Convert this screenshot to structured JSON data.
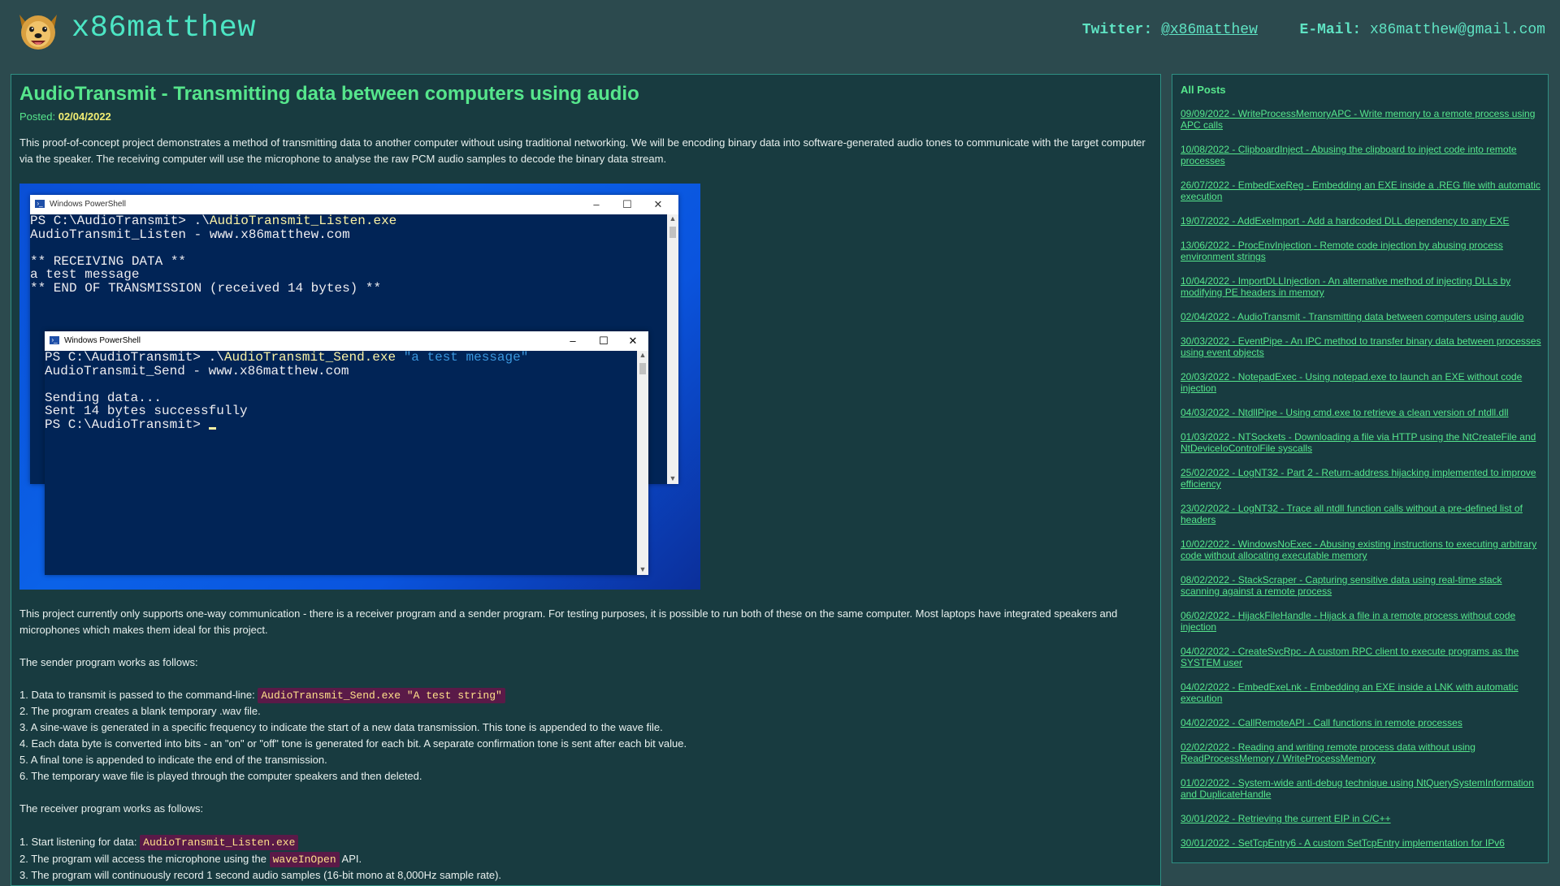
{
  "header": {
    "site_title": "x86matthew",
    "logo_icon": "dog-face-logo-icon",
    "twitter_label": "Twitter:",
    "twitter_handle": "@x86matthew",
    "email_label": "E-Mail:",
    "email_address": "x86matthew@gmail.com"
  },
  "article": {
    "title": "AudioTransmit - Transmitting data between computers using audio",
    "posted_label": "Posted:",
    "posted_date": "02/04/2022",
    "intro": "This proof-of-concept project demonstrates a method of transmitting data to another computer without using traditional networking. We will be encoding binary data into software-generated audio tones to communicate with the target computer via the speaker. The receiving computer will use the microphone to analyse the raw PCM audio samples to decode the binary data stream.",
    "screenshot": {
      "back_window": {
        "title": "Windows PowerShell",
        "prompt": "PS C:\\AudioTransmit> .\\",
        "exe": "AudioTransmit_Listen.exe",
        "lines": [
          "AudioTransmit_Listen - www.x86matthew.com",
          "",
          "** RECEIVING DATA **",
          "a test message",
          "** END OF TRANSMISSION (received 14 bytes) **"
        ]
      },
      "front_window": {
        "title": "Windows PowerShell",
        "prompt": "PS C:\\AudioTransmit> .\\",
        "exe": "AudioTransmit_Send.exe",
        "arg": "\"a test message\"",
        "lines": [
          "AudioTransmit_Send - www.x86matthew.com",
          "",
          "Sending data...",
          "Sent 14 bytes successfully"
        ],
        "final_prompt": "PS C:\\AudioTransmit> "
      },
      "minimize_glyph": "–",
      "maximize_glyph": "☐",
      "close_glyph": "✕"
    },
    "para2": "This project currently only supports one-way communication - there is a receiver program and a sender program. For testing purposes, it is possible to run both of these on the same computer. Most laptops have integrated speakers and microphones which makes them ideal for this project.",
    "sender_intro": "The sender program works as follows:",
    "sender_steps": {
      "s1_text": "1. Data to transmit is passed to the command-line:",
      "s1_code": "AudioTransmit_Send.exe \"A test string\"",
      "s2": "2. The program creates a blank temporary .wav file.",
      "s3": "3. A sine-wave is generated in a specific frequency to indicate the start of a new data transmission. This tone is appended to the wave file.",
      "s4": "4. Each data byte is converted into bits - an \"on\" or \"off\" tone is generated for each bit. A separate confirmation tone is sent after each bit value.",
      "s5": "5. A final tone is appended to indicate the end of the transmission.",
      "s6": "6. The temporary wave file is played through the computer speakers and then deleted."
    },
    "receiver_intro": "The receiver program works as follows:",
    "receiver_steps": {
      "r1_text": "1. Start listening for data:",
      "r1_code": "AudioTransmit_Listen.exe",
      "r2_pre": "2. The program will access the microphone using the",
      "r2_code": "waveInOpen",
      "r2_post": "API.",
      "r3": "3. The program will continuously record 1 second audio samples (16-bit mono at 8,000Hz sample rate)."
    }
  },
  "sidebar": {
    "heading": "All Posts",
    "posts": [
      "09/09/2022 - WriteProcessMemoryAPC - Write memory to a remote process using APC calls",
      "10/08/2022 - ClipboardInject - Abusing the clipboard to inject code into remote processes",
      "26/07/2022 - EmbedExeReg - Embedding an EXE inside a .REG file with automatic execution",
      "19/07/2022 - AddExeImport - Add a hardcoded DLL dependency to any EXE",
      "13/06/2022 - ProcEnvInjection - Remote code injection by abusing process environment strings",
      "10/04/2022 - ImportDLLInjection - An alternative method of injecting DLLs by modifying PE headers in memory",
      "02/04/2022 - AudioTransmit - Transmitting data between computers using audio",
      "30/03/2022 - EventPipe - An IPC method to transfer binary data between processes using event objects",
      "20/03/2022 - NotepadExec - Using notepad.exe to launch an EXE without code injection",
      "04/03/2022 - NtdllPipe - Using cmd.exe to retrieve a clean version of ntdll.dll",
      "01/03/2022 - NTSockets - Downloading a file via HTTP using the NtCreateFile and NtDeviceIoControlFile syscalls",
      "25/02/2022 - LogNT32 - Part 2 - Return-address hijacking implemented to improve efficiency",
      "23/02/2022 - LogNT32 - Trace all ntdll function calls without a pre-defined list of headers",
      "10/02/2022 - WindowsNoExec - Abusing existing instructions to executing arbitrary code without allocating executable memory",
      "08/02/2022 - StackScraper - Capturing sensitive data using real-time stack scanning against a remote process",
      "06/02/2022 - HijackFileHandle - Hijack a file in a remote process without code injection",
      "04/02/2022 - CreateSvcRpc - A custom RPC client to execute programs as the SYSTEM user",
      "04/02/2022 - EmbedExeLnk - Embedding an EXE inside a LNK with automatic execution",
      "04/02/2022 - CallRemoteAPI - Call functions in remote processes",
      "02/02/2022 - Reading and writing remote process data without using ReadProcessMemory / WriteProcessMemory",
      "01/02/2022 - System-wide anti-debug technique using NtQuerySystemInformation and DuplicateHandle",
      "30/01/2022 - Retrieving the current EIP in C/C++",
      "30/01/2022 - SetTcpEntry6 - A custom SetTcpEntry implementation for IPv6"
    ]
  },
  "colors": {
    "page_bg": "#2c4a4e",
    "panel_bg": "#183b40",
    "accent_green": "#56e68c",
    "title_teal": "#4ce6c4",
    "code_bg": "#5a1a48",
    "code_fg": "#ffe08a",
    "date_yellow": "#f2ee73"
  }
}
